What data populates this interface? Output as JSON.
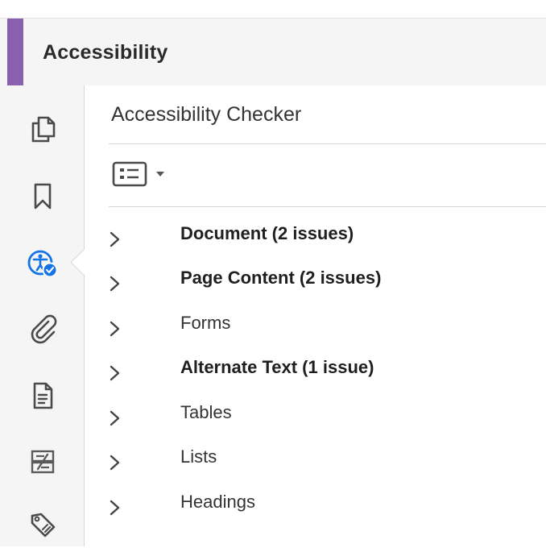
{
  "header": {
    "title": "Accessibility",
    "accent_color": "#8b5fb0"
  },
  "toolbar": {
    "tools": [
      {
        "name": "pages-icon",
        "active": false
      },
      {
        "name": "bookmark-icon",
        "active": false
      },
      {
        "name": "accessibility-check-icon",
        "active": true
      },
      {
        "name": "attachment-icon",
        "active": false
      },
      {
        "name": "page-document-icon",
        "active": false
      },
      {
        "name": "content-order-icon",
        "active": false
      },
      {
        "name": "tags-icon",
        "active": false
      }
    ]
  },
  "panel": {
    "title": "Accessibility Checker",
    "options_icon": "list-options-icon",
    "items": [
      {
        "label": "Document (2 issues)",
        "has_issues": true
      },
      {
        "label": "Page Content (2 issues)",
        "has_issues": true
      },
      {
        "label": "Forms",
        "has_issues": false
      },
      {
        "label": "Alternate Text (1 issue)",
        "has_issues": true
      },
      {
        "label": "Tables",
        "has_issues": false
      },
      {
        "label": "Lists",
        "has_issues": false
      },
      {
        "label": "Headings",
        "has_issues": false
      }
    ]
  },
  "colors": {
    "accent": "#8b5fb0",
    "active_icon_blue": "#1473e6"
  }
}
